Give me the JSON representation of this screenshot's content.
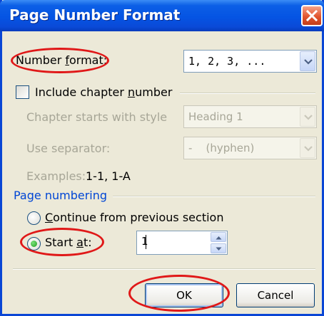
{
  "dialog": {
    "title": "Page Number Format",
    "close_icon": "close-icon",
    "number_format": {
      "label_pre": "Number ",
      "label_ul": "f",
      "label_post": "ormat:",
      "value": "1, 2, 3, ..."
    },
    "include_chapter": {
      "label_pre": "Include chapter ",
      "label_ul": "n",
      "label_post": "umber",
      "checked": false
    },
    "chapter_style": {
      "label": "Chapter starts with style",
      "value": "Heading 1"
    },
    "separator": {
      "label": "Use separator:",
      "value": "-    (hyphen)"
    },
    "examples": {
      "label": "Examples:",
      "value": "1-1, 1-A"
    },
    "page_numbering": {
      "heading": "Page numbering",
      "continue": {
        "label_ul": "C",
        "label_post": "ontinue from previous section",
        "selected": false
      },
      "start_at": {
        "label_pre": "Start ",
        "label_ul": "a",
        "label_post": "t:",
        "selected": true,
        "value": "1"
      }
    },
    "ok_label": "OK",
    "cancel_label": "Cancel"
  },
  "annotation_color": "#e01818"
}
